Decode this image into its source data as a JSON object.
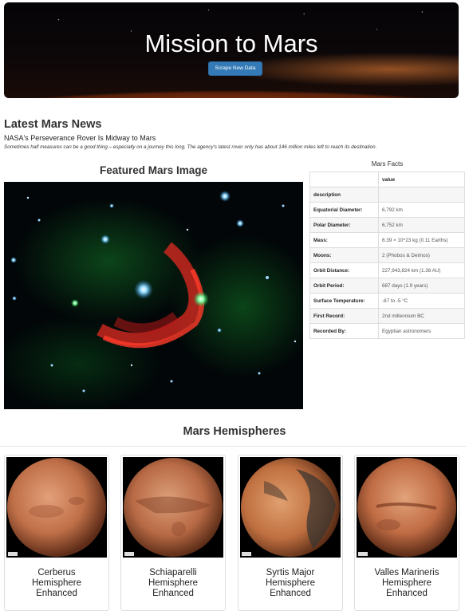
{
  "header": {
    "title": "Mission to Mars",
    "scrape_button": "Scrape New Data"
  },
  "news": {
    "heading": "Latest Mars News",
    "title": "NASA's Perseverance Rover Is Midway to Mars",
    "teaser": "Sometimes half measures can be a good thing – especially on a journey this long. The agency's latest rover only has about 146 million miles left to reach its destination."
  },
  "featured": {
    "heading": "Featured Mars Image"
  },
  "facts": {
    "heading": "Mars Facts",
    "header_label": "",
    "header_value": "value",
    "rows": [
      {
        "label": "description",
        "value": ""
      },
      {
        "label": "Equatorial Diameter:",
        "value": "6,792 km"
      },
      {
        "label": "Polar Diameter:",
        "value": "6,752 km"
      },
      {
        "label": "Mass:",
        "value": "6.39 × 10^23 kg (0.11 Earths)"
      },
      {
        "label": "Moons:",
        "value": "2 (Phobos & Deimos)"
      },
      {
        "label": "Orbit Distance:",
        "value": "227,943,824 km (1.38 AU)"
      },
      {
        "label": "Orbit Period:",
        "value": "687 days (1.9 years)"
      },
      {
        "label": "Surface Temperature:",
        "value": "-87 to -5 °C"
      },
      {
        "label": "First Record:",
        "value": "2nd millennium BC"
      },
      {
        "label": "Recorded By:",
        "value": "Egyptian astronomers"
      }
    ]
  },
  "hemispheres": {
    "heading": "Mars Hemispheres",
    "items": [
      {
        "title": "Cerberus Hemisphere Enhanced"
      },
      {
        "title": "Schiaparelli Hemisphere Enhanced"
      },
      {
        "title": "Syrtis Major Hemisphere Enhanced"
      },
      {
        "title": "Valles Marineris Hemisphere Enhanced"
      }
    ]
  }
}
